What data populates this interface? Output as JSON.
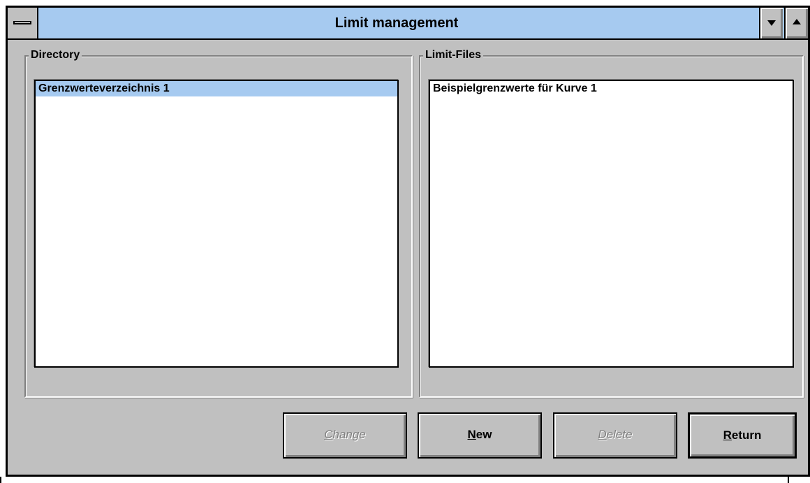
{
  "window": {
    "title": "Limit management"
  },
  "directory": {
    "label": "Directory",
    "items": [
      {
        "label": "Grenzwerteverzeichnis 1",
        "selected": true
      }
    ]
  },
  "limit_files": {
    "label": "Limit-Files",
    "items": [
      {
        "label": "Beispielgrenzwerte für Kurve 1",
        "selected": false
      }
    ]
  },
  "buttons": {
    "change": {
      "label": "Change",
      "enabled": false
    },
    "new": {
      "label": "New",
      "enabled": true
    },
    "delete": {
      "label": "Delete",
      "enabled": false
    },
    "return": {
      "label": "Return",
      "enabled": true
    }
  },
  "icons": {
    "system_menu": "system-menu-icon",
    "minimize": "minimize-icon",
    "maximize": "maximize-icon"
  },
  "colors": {
    "titlebar": "#a6caf0",
    "face": "#c0c0c0",
    "selection": "#a6caf0",
    "disabled_text": "#808080"
  }
}
